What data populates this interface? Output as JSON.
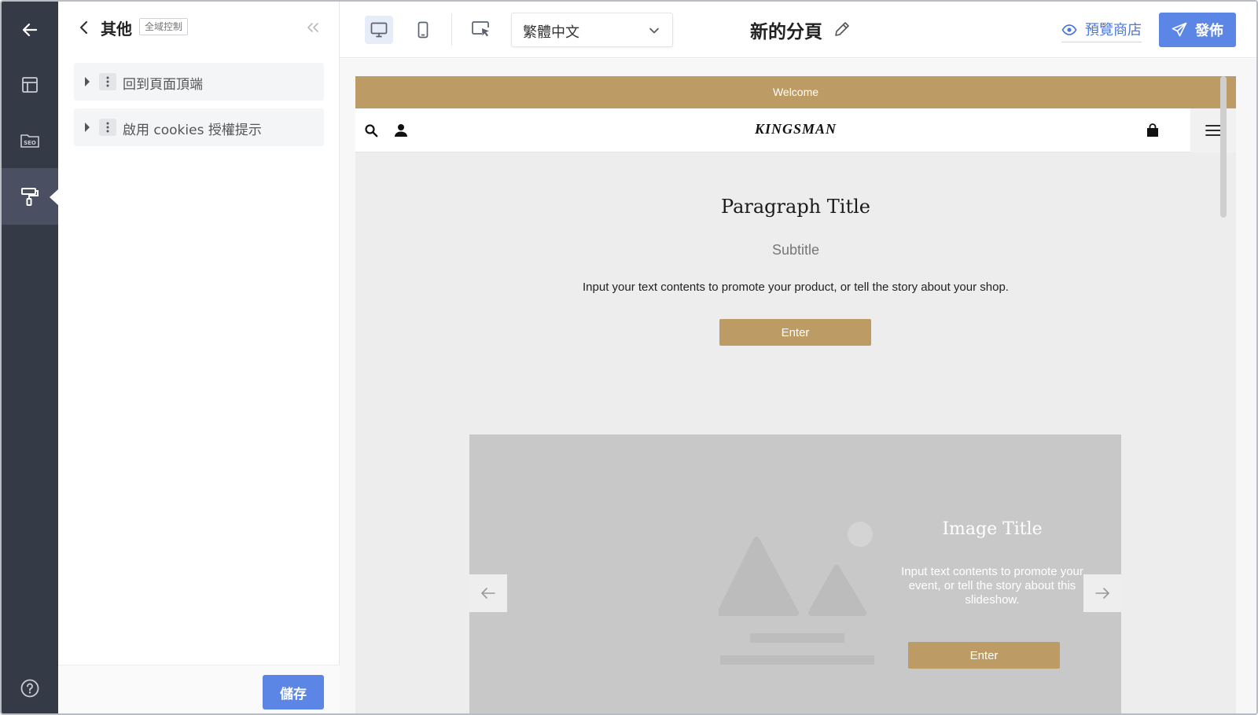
{
  "sidebar_rail": {
    "icons": [
      "back-arrow-icon",
      "layout-icon",
      "seo-folder-icon",
      "paint-roller-icon",
      "help-icon"
    ],
    "active": "paint-roller-icon",
    "seo_label": "SEO"
  },
  "panel": {
    "title": "其他",
    "badge": "全域控制",
    "items": [
      {
        "label": "回到頁面頂端"
      },
      {
        "label": "啟用 cookies 授權提示"
      }
    ],
    "save_label": "儲存"
  },
  "topbar": {
    "device_modes": [
      "desktop-icon",
      "mobile-icon"
    ],
    "active_device": "desktop-icon",
    "language": "繁體中文",
    "page_name": "新的分頁",
    "preview_label": "預覽商店",
    "publish_label": "發佈"
  },
  "site": {
    "announcement": "Welcome",
    "logo": "KINGSMAN",
    "paragraph": {
      "title": "Paragraph Title",
      "subtitle": "Subtitle",
      "body": "Input your text contents to promote your product, or tell the story about your shop.",
      "button": "Enter"
    },
    "slideshow": {
      "title": "Image Title",
      "text": "Input text contents to promote your event, or tell the story about this slideshow.",
      "button": "Enter"
    }
  },
  "colors": {
    "rail_bg": "#353a47",
    "accent_blue": "#5b86e5",
    "gold": "#bc9c64"
  }
}
